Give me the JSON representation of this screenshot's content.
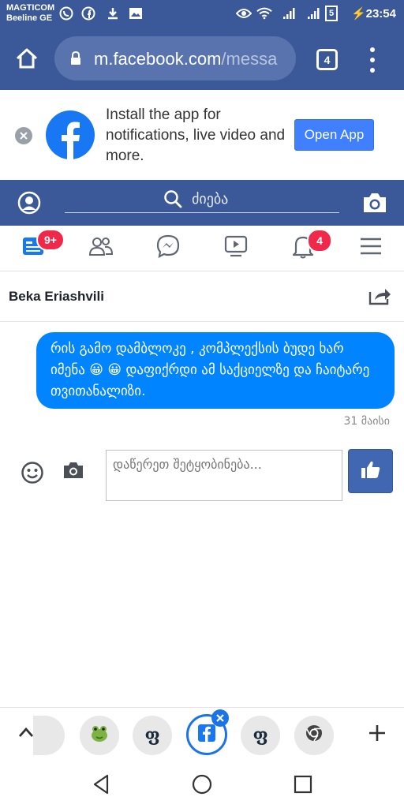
{
  "status_bar": {
    "carrier1": "MAGTICOM",
    "carrier2": "Beeline GE",
    "sim_label": "5",
    "time": "23:54"
  },
  "browser": {
    "url_main": "m.facebook.com",
    "url_rest": "/messa",
    "tabs_count": "4"
  },
  "install_banner": {
    "text": "Install the app for notifications, live video and more.",
    "button_label": "Open App"
  },
  "fb_header": {
    "search_placeholder": "ძიება"
  },
  "nav": {
    "feed_badge": "9+",
    "notifications_badge": "4"
  },
  "conversation": {
    "name": "Beka Eriashvili",
    "message_text": "რის გამო დამბლოკე , კომპლექსის ბუდე ხარ იმენა 😀 😀  დაფიქრდი ამ საქციელზე და ჩაიტარე თვითანალიზი.",
    "message_date": "31 მაისი",
    "composer_placeholder": "დაწერეთ შეტყობინება..."
  },
  "tab_strip": {
    "tab_letter": "ფ"
  },
  "colors": {
    "brand": "#3b5998",
    "bubble": "#0084ff",
    "badge": "#f02849",
    "open_app": "#4080ff"
  },
  "icons": [
    "home-icon",
    "lock-icon",
    "menu-dots-icon",
    "facebook-logo-icon",
    "profile-icon",
    "search-icon",
    "camera-icon",
    "feed-icon",
    "friends-icon",
    "messenger-icon",
    "watch-icon",
    "bell-icon",
    "hamburger-icon",
    "share-icon",
    "emoji-icon",
    "thumbs-up-icon",
    "chevron-up-icon",
    "plus-icon",
    "back-icon",
    "home-circle-icon",
    "recents-icon"
  ]
}
